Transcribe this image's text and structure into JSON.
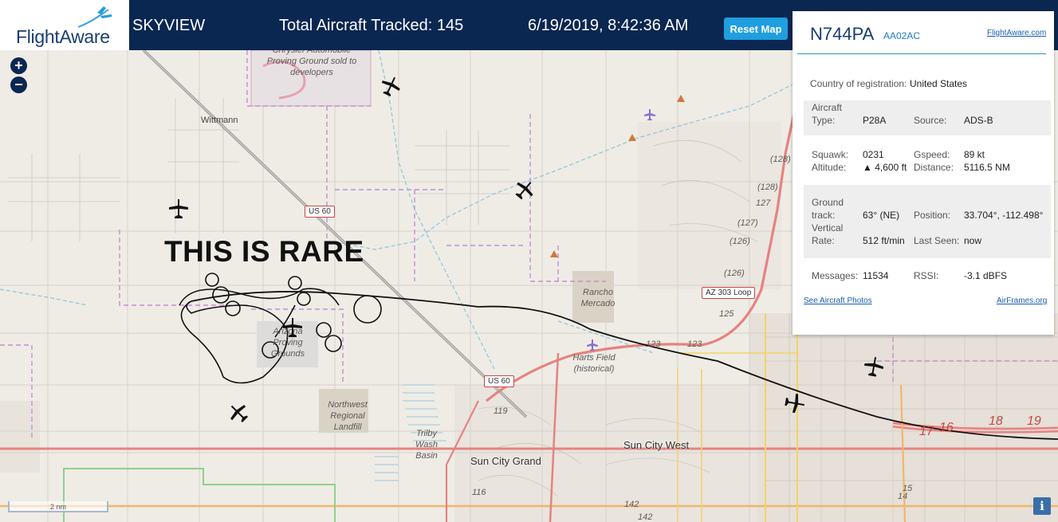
{
  "header": {
    "logo_text": "FlightAware",
    "app_name": "SKYVIEW",
    "total_tracked": "Total Aircraft Tracked: 145",
    "datetime": "6/19/2019, 8:42:36 AM",
    "reset_label": "Reset Map"
  },
  "map": {
    "overlay_text": "THIS IS RARE",
    "zoom_in": "+",
    "zoom_out": "−",
    "scale_label": "2 nm",
    "info_label": "i",
    "places": {
      "chrysler": "Chrysler Automobile Proving Ground sold to developers",
      "wittmann": "Wittmann",
      "rancho": "Rancho Mercado",
      "harts": "Harts Field (historical)",
      "arizona_pg": "Arizona Proving Grounds",
      "northwest": "Northwest Regional Landfill",
      "trilby": "Trilby Wash Basin",
      "sun_city_grand": "Sun City Grand",
      "sun_city_west": "Sun City West"
    },
    "shields": {
      "us60_a": "US 60",
      "us60_b": "US 60",
      "az303": "AZ 303 Loop"
    },
    "road_numbers": {
      "r128a": "(128)",
      "r128b": "(128)",
      "r127a": "127",
      "r127b": "(127)",
      "r126a": "(126)",
      "r126b": "(126)",
      "r125": "125",
      "r123a": "123",
      "r123b": "123",
      "r119": "119",
      "r116": "116",
      "r142a": "142",
      "r142b": "142",
      "r15": "15",
      "r14": "14",
      "r17": "17",
      "r16": "16",
      "r18": "18",
      "r19": "19"
    }
  },
  "panel": {
    "registration": "N744PA",
    "hex": "AA02AC",
    "flightaware_link": "FlightAware.com",
    "country_label": "Country of registration:",
    "country_value": "United States",
    "aircraft_type_label": "Aircraft Type:",
    "aircraft_type_value": "P28A",
    "source_label": "Source:",
    "source_value": "ADS-B",
    "squawk_label": "Squawk:",
    "squawk_value": "0231",
    "gspeed_label": "Gspeed:",
    "gspeed_value": "89 kt",
    "altitude_label": "Altitude:",
    "altitude_value": "▲ 4,600 ft",
    "distance_label": "Distance:",
    "distance_value": "5116.5 NM",
    "ground_track_label": "Ground track:",
    "ground_track_value": "63° (NE)",
    "position_label": "Position:",
    "position_value": "33.704°, -112.498°",
    "vertical_rate_label": "Vertical Rate:",
    "vertical_rate_value": "512 ft/min",
    "last_seen_label": "Last Seen:",
    "last_seen_value": "now",
    "messages_label": "Messages:",
    "messages_value": "11534",
    "rssi_label": "RSSI:",
    "rssi_value": "-3.1 dBFS",
    "photos_link": "See Aircraft Photos",
    "airframes_link": "AirFrames.org"
  },
  "colors": {
    "header_bg": "#0a2752",
    "accent": "#1f9ee0",
    "map_bg": "#efece6",
    "highway": "#e5837f",
    "boundary": "#c28ed3",
    "water": "#8fc7de"
  }
}
